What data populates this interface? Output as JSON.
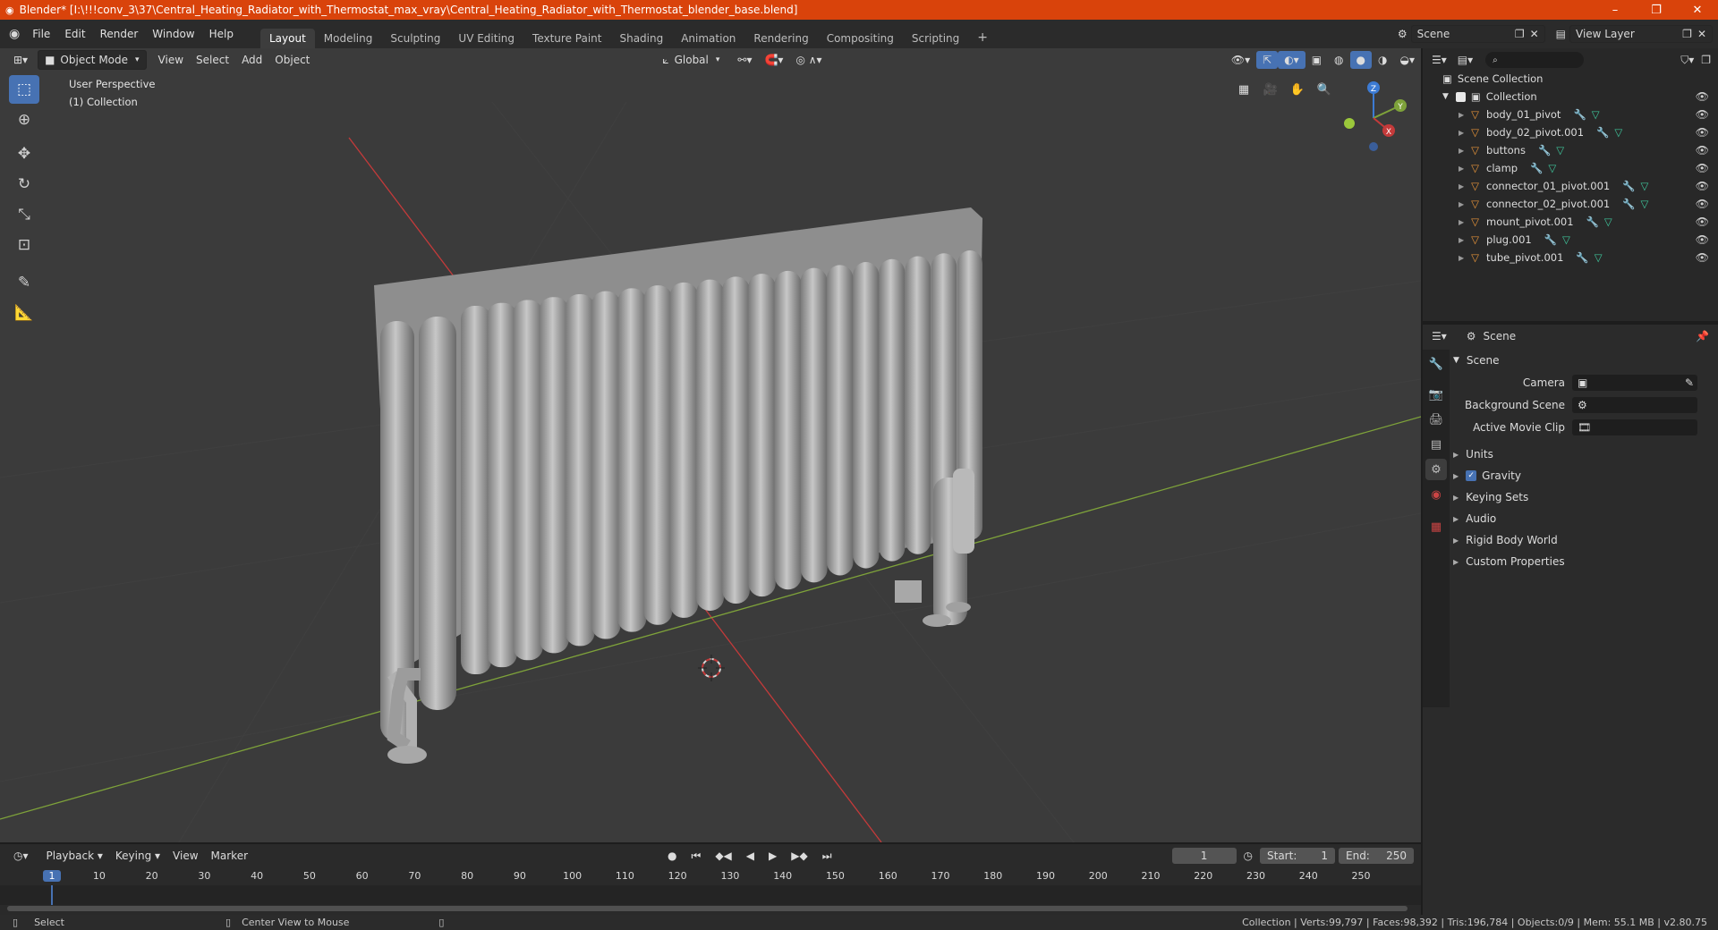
{
  "window": {
    "title": "Blender* [I:\\!!!conv_3\\37\\Central_Heating_Radiator_with_Thermostat_max_vray\\Central_Heating_Radiator_with_Thermostat_blender_base.blend]",
    "minimize": "–",
    "restore": "❐",
    "close": "✕"
  },
  "menu": [
    "File",
    "Edit",
    "Render",
    "Window",
    "Help"
  ],
  "workspaces": [
    "Layout",
    "Modeling",
    "Sculpting",
    "UV Editing",
    "Texture Paint",
    "Shading",
    "Animation",
    "Rendering",
    "Compositing",
    "Scripting"
  ],
  "scene_field": "Scene",
  "view_layer_field": "View Layer",
  "viewport": {
    "mode": "Object Mode",
    "menus": [
      "View",
      "Select",
      "Add",
      "Object"
    ],
    "transform": "Global",
    "perspective_label": "User Perspective",
    "collection_label": "(1) Collection"
  },
  "gizmo": {
    "z": "Z",
    "y": "Y",
    "x": "X"
  },
  "outliner": {
    "search_placeholder": "",
    "root": "Scene Collection",
    "collection": "Collection",
    "items": [
      "body_01_pivot",
      "body_02_pivot.001",
      "buttons",
      "clamp",
      "connector_01_pivot.001",
      "connector_02_pivot.001",
      "mount_pivot.001",
      "plug.001",
      "tube_pivot.001"
    ]
  },
  "properties": {
    "header": "Scene",
    "panel": "Scene",
    "camera_label": "Camera",
    "bg_scene_label": "Background Scene",
    "movie_clip_label": "Active Movie Clip",
    "sections": [
      "Units",
      "Gravity",
      "Keying Sets",
      "Audio",
      "Rigid Body World",
      "Custom Properties"
    ],
    "gravity_checked": true
  },
  "timeline": {
    "menus": [
      "Playback",
      "Keying",
      "View",
      "Marker"
    ],
    "current_frame": "1",
    "start_label": "Start:",
    "start": "1",
    "end_label": "End:",
    "end": "250",
    "ticks": [
      "1",
      "10",
      "20",
      "30",
      "40",
      "50",
      "60",
      "70",
      "80",
      "90",
      "100",
      "110",
      "120",
      "130",
      "140",
      "150",
      "160",
      "170",
      "180",
      "190",
      "200",
      "210",
      "220",
      "230",
      "240",
      "250"
    ]
  },
  "status": {
    "select": "Select",
    "center_view": "Center View to Mouse",
    "stats": "Collection | Verts:99,797 | Faces:98,392 | Tris:196,784 | Objects:0/9 | Mem: 55.1 MB | v2.80.75"
  },
  "colors": {
    "title_bar": "#d9430b",
    "accent": "#4772b3",
    "x_axis": "#c43a3a",
    "y_axis": "#7ea23a",
    "orange_icon": "#e8953a"
  }
}
